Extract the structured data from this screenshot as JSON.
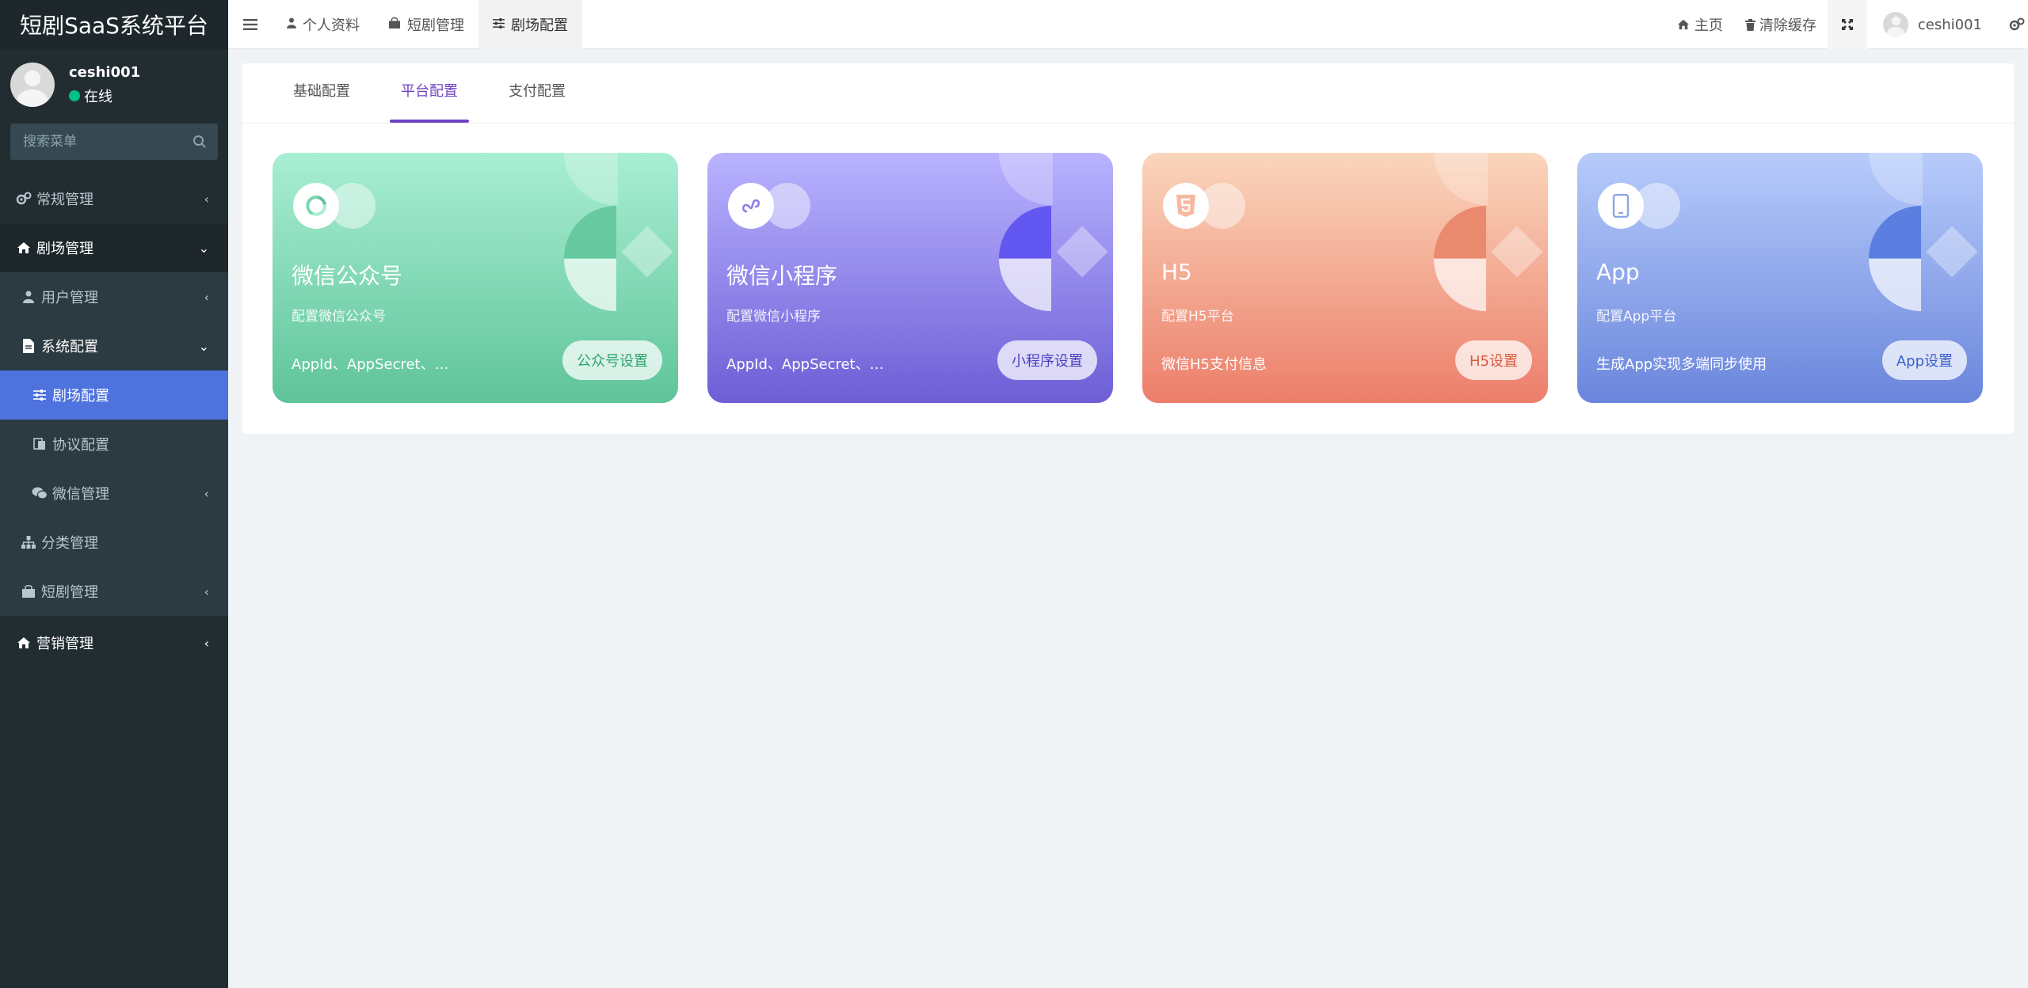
{
  "brand": {
    "title": "短剧SaaS系统平台"
  },
  "user": {
    "name": "ceshi001",
    "status": "在线"
  },
  "sidebar": {
    "search_placeholder": "搜索菜单",
    "items": [
      {
        "label": "常规管理"
      },
      {
        "label": "剧场管理"
      },
      {
        "label": "用户管理"
      },
      {
        "label": "系统配置"
      },
      {
        "label": "剧场配置"
      },
      {
        "label": "协议配置"
      },
      {
        "label": "微信管理"
      },
      {
        "label": "分类管理"
      },
      {
        "label": "短剧管理"
      },
      {
        "label": "营销管理"
      }
    ]
  },
  "topnav": {
    "tabs": [
      {
        "label": "个人资料"
      },
      {
        "label": "短剧管理"
      },
      {
        "label": "剧场配置"
      }
    ],
    "home": "主页",
    "clear_cache": "清除缓存",
    "username": "ceshi001"
  },
  "panel": {
    "tabs": [
      {
        "label": "基础配置"
      },
      {
        "label": "平台配置"
      },
      {
        "label": "支付配置"
      }
    ]
  },
  "cards": [
    {
      "title": "微信公众号",
      "subtitle": "配置微信公众号",
      "desc": "AppId、AppSecret、自定义菜单",
      "button": "公众号设置",
      "color": "#5fc49a"
    },
    {
      "title": "微信小程序",
      "subtitle": "配置微信小程序",
      "desc": "AppId、AppSecret、自定义配置",
      "button": "小程序设置",
      "color": "#6d5ed6"
    },
    {
      "title": "H5",
      "subtitle": "配置H5平台",
      "desc": "微信H5支付信息",
      "button": "H5设置",
      "color": "#ec7e6a"
    },
    {
      "title": "App",
      "subtitle": "配置App平台",
      "desc": "生成App实现多端同步使用",
      "button": "App设置",
      "color": "#6a86dc"
    }
  ]
}
